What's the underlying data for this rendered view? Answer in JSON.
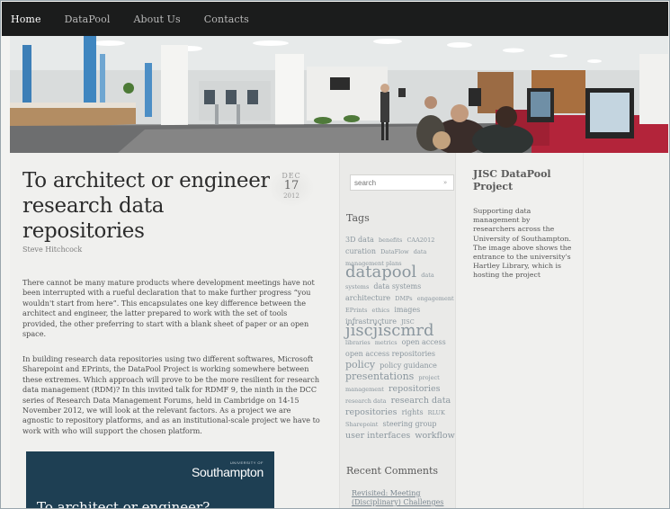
{
  "nav": {
    "items": [
      "Home",
      "DataPool",
      "About Us",
      "Contacts"
    ]
  },
  "post": {
    "title": "To architect or engineer research data repositories",
    "author": "Steve Hitchcock",
    "date": {
      "month": "DEC",
      "day": "17",
      "year": "2012"
    },
    "paragraph1": "There cannot be many mature products where development meetings have not been interrupted with a rueful declaration that to make further progress “you wouldn't start from here”. This encapsulates one key difference between the architect and engineer, the latter prepared to work with the set of tools provided, the other preferring to start with a blank sheet of paper or an open space.",
    "paragraph2": "In building research data repositories using two different softwares, Microsoft Sharepoint and EPrints, the DataPool Project is working somewhere between these extremes. Which approach will prove to be the more resilient for research data management (RDM)? In this invited talk for RDMF 9, the ninth in the DCC series of Research Data Management Forums, held in Cambridge on 14-15 November 2012, we will look at the relevant factors. As a project we are agnostic to repository platforms, and as an institutional-scale project we have to work with who will support the chosen platform.",
    "promo": {
      "logo_small": "UNIVERSITY OF",
      "logo_big": "Southampton",
      "title": "To architect or engineer?"
    }
  },
  "sidebar": {
    "search_placeholder": "search",
    "search_button": "»",
    "tags_heading": "Tags",
    "tags": [
      {
        "text": "3D data",
        "size": 8
      },
      {
        "text": "benefits",
        "size": 6.5
      },
      {
        "text": "CAA2012",
        "size": 6.5
      },
      {
        "text": "curation",
        "size": 8
      },
      {
        "text": "DataFlow",
        "size": 6.5
      },
      {
        "text": "data management plans",
        "size": 6.5
      },
      {
        "text": "datapool",
        "size": 18
      },
      {
        "text": "data systems",
        "size": 6.5
      },
      {
        "text": "data systems architecture",
        "size": 8
      },
      {
        "text": "DMPs",
        "size": 6.5
      },
      {
        "text": "engagement",
        "size": 6.5
      },
      {
        "text": "EPrints",
        "size": 6.5
      },
      {
        "text": "ethics",
        "size": 6.5
      },
      {
        "text": "images",
        "size": 8
      },
      {
        "text": "infrastructure",
        "size": 8
      },
      {
        "text": "JISC",
        "size": 6.5
      },
      {
        "text": "jiscjiscmrd",
        "size": 18
      },
      {
        "text": "libraries",
        "size": 6.5
      },
      {
        "text": "metrics",
        "size": 6.5
      },
      {
        "text": "open access",
        "size": 8
      },
      {
        "text": "open access repositories",
        "size": 8
      },
      {
        "text": "policy",
        "size": 11
      },
      {
        "text": "policy guidance",
        "size": 8
      },
      {
        "text": "presentations",
        "size": 11
      },
      {
        "text": "project management",
        "size": 6.5
      },
      {
        "text": "repositories",
        "size": 9.5
      },
      {
        "text": "research data",
        "size": 6.5
      },
      {
        "text": "research data repositories",
        "size": 9.5
      },
      {
        "text": "rights",
        "size": 8
      },
      {
        "text": "RLUK",
        "size": 6.5
      },
      {
        "text": "Sharepoint",
        "size": 6.5
      },
      {
        "text": "steering group",
        "size": 8
      },
      {
        "text": "user interfaces",
        "size": 9.5
      },
      {
        "text": "workflow",
        "size": 9.5
      }
    ],
    "comments_heading": "Recent Comments",
    "comment_link": "Revisited: Meeting (Disciplinary) Challenges in"
  },
  "right_sidebar": {
    "heading": "JISC DataPool Project",
    "text": "Supporting data management by researchers across the University of Southampton. The image above shows the entrance to the university's Hartley Library, which is hosting the project"
  },
  "colors": {
    "nav_bg": "#1b1c1c",
    "promo_bg": "#1e3f53",
    "tag_color": "#8a969e"
  }
}
